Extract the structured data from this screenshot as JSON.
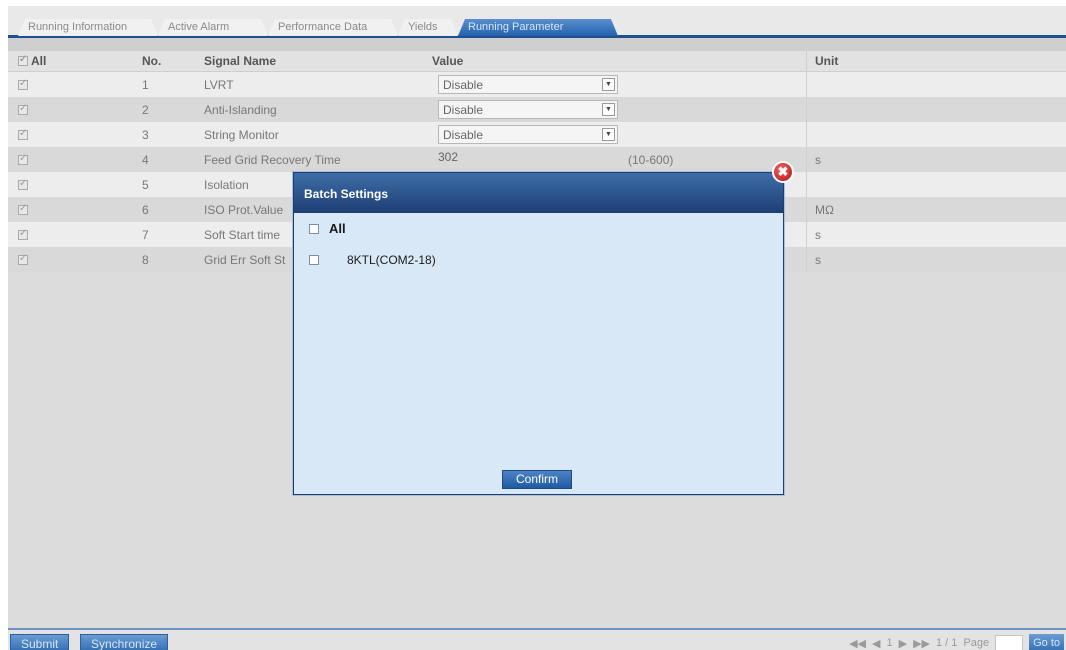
{
  "tabs": [
    {
      "label": "Running Information"
    },
    {
      "label": "Active Alarm"
    },
    {
      "label": "Performance Data"
    },
    {
      "label": "Yields"
    },
    {
      "label": "Running Parameter"
    }
  ],
  "table": {
    "headers": {
      "all": "All",
      "no": "No.",
      "signal": "Signal Name",
      "value": "Value",
      "unit": "Unit"
    },
    "rows": [
      {
        "no": "1",
        "name": "LVRT",
        "value": "Disable",
        "range": "",
        "unit": ""
      },
      {
        "no": "2",
        "name": "Anti-Islanding",
        "value": "Disable",
        "range": "",
        "unit": ""
      },
      {
        "no": "3",
        "name": "String Monitor",
        "value": "Disable",
        "range": "",
        "unit": ""
      },
      {
        "no": "4",
        "name": "Feed Grid Recovery Time",
        "value": "302",
        "range": "(10-600)",
        "unit": "s"
      },
      {
        "no": "5",
        "name": "Isolation",
        "value": "",
        "range": "",
        "unit": ""
      },
      {
        "no": "6",
        "name": "ISO Prot.Value",
        "value": "",
        "range": "",
        "unit": "MΩ"
      },
      {
        "no": "7",
        "name": "Soft Start time",
        "value": "",
        "range": "",
        "unit": "s"
      },
      {
        "no": "8",
        "name": "Grid Err Soft St",
        "value": "",
        "range": "",
        "unit": "s"
      }
    ]
  },
  "bottom": {
    "submit": "Submit",
    "synchronize": "Synchronize",
    "pager": {
      "first": "◀◀",
      "prev": "◀",
      "page": "1",
      "next": "▶",
      "last": "▶▶",
      "count": "1 / 1",
      "page_label": "Page",
      "goto": "Go to"
    }
  },
  "modal": {
    "title": "Batch Settings",
    "all_label": "All",
    "device_label": "8KTL(COM2-18)",
    "confirm": "Confirm",
    "close": "✖"
  }
}
